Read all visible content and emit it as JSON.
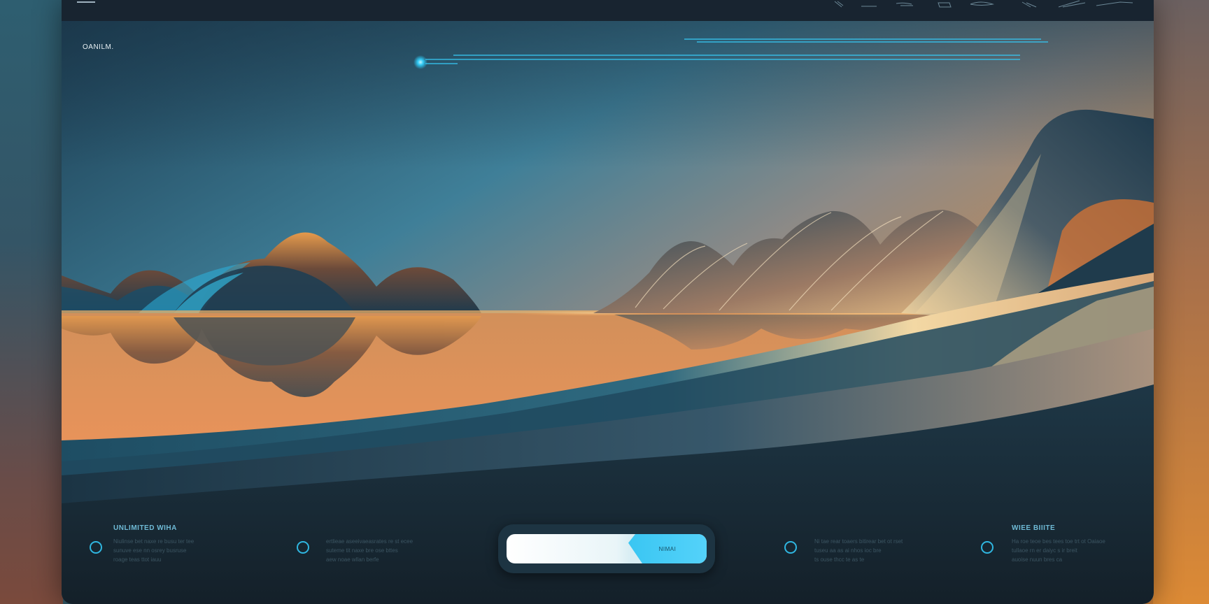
{
  "app": {
    "topbar_title": "",
    "brand": "OANILM."
  },
  "colors": {
    "accent": "#2fb6e0",
    "cta": "#3ac6f2",
    "sky_top": "#1c3d52",
    "sky_warm": "#e0913f",
    "panel": "#16222c"
  },
  "icons": {
    "menu": "hamburger-menu-icon",
    "bullet": "ring-icon",
    "status_dot": "glow-dot-icon"
  },
  "footer": {
    "left_block": {
      "title": "UNLIMITED WIHA",
      "lines": [
        "Niulinse bet naxe re busu ter tee",
        "sunuve ese nn osrey busruse",
        "roage teas ttot iauu"
      ]
    },
    "left_mid_block": {
      "lines": [
        "ertlieae aseeivaeasrates re st ecee",
        "suteme tit naxe bre ose bttes",
        "aew noae wllan berfe"
      ]
    },
    "cta": {
      "placeholder": "",
      "button_label": "NIMAI"
    },
    "right_mid_block": {
      "lines": [
        "Ni tae rear toaers bitirear bet ot rset",
        "tuseu aa as ai nhos ioc bre",
        "ts ouse thcc te as te"
      ]
    },
    "right_block": {
      "title": "WIEE BIIITE",
      "lines": [
        "Ha roe teoe bes tees toe trt ot Oaiaoe",
        "tullaoe rn er daiyc s ir breit",
        "auoise nuun bres ca"
      ]
    }
  }
}
